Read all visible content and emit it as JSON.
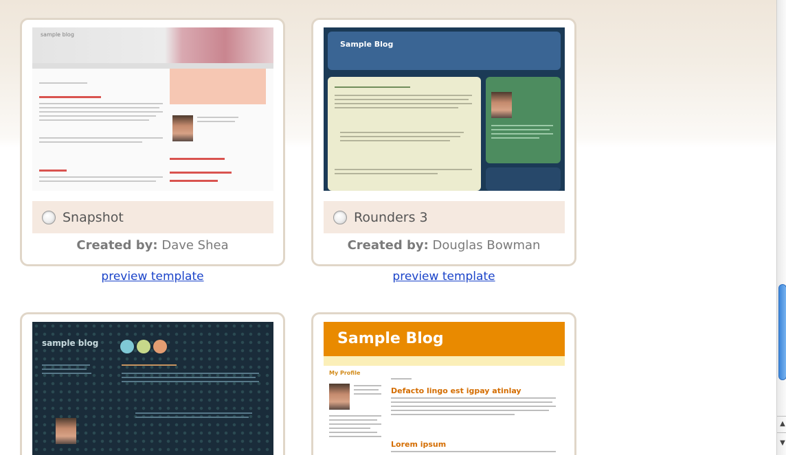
{
  "templates": [
    {
      "name": "Snapshot",
      "created_prefix": "Created by:",
      "author": "Dave Shea",
      "preview": "preview template",
      "thumb_title": "sample blog"
    },
    {
      "name": "Rounders 3",
      "created_prefix": "Created by:",
      "author": "Douglas Bowman",
      "preview": "preview template",
      "thumb_title": "Sample Blog"
    },
    {
      "thumb_title": "sample blog"
    },
    {
      "thumb_title": "Sample Blog",
      "thumb_post1": "Defacto lingo est igpay atinlay",
      "thumb_post2": "Lorem ipsum",
      "thumb_profile": "My Profile"
    }
  ],
  "colors": {
    "link": "#1a43c9",
    "card_border": "#e0d6c8",
    "radio_row": "#f5e9e0",
    "scroll_thumb": "#3c85d9"
  },
  "icons": [
    "radio-icon",
    "scroll-up-arrow-icon",
    "scroll-down-arrow-icon"
  ]
}
